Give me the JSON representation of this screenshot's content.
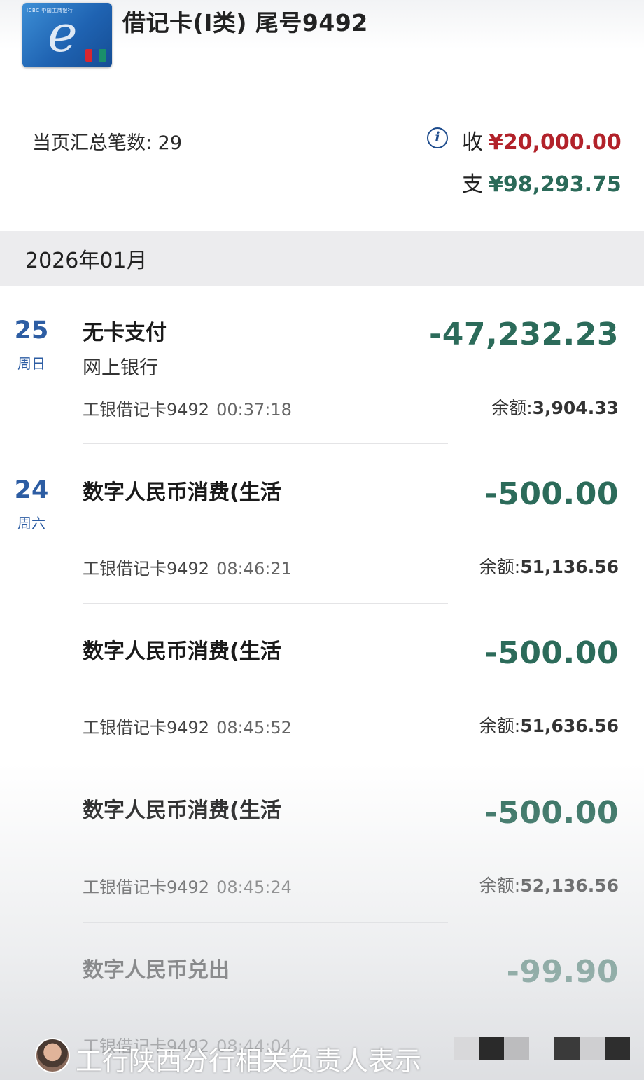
{
  "header": {
    "card_thumb_text": "ICBC 中国工商银行",
    "card_title": "借记卡(I类) 尾号9492",
    "summary_count": "当页汇总笔数: 29",
    "income_label": "收",
    "income_amount": "¥20,000.00",
    "expense_label": "支",
    "expense_amount": "¥98,293.75",
    "info_icon_glyph": "i"
  },
  "month": "2026年01月",
  "transactions": [
    {
      "day": "25",
      "weekday": "周日",
      "title": "无卡支付",
      "subtitle": "网上银行",
      "account": "工银借记卡9492",
      "time": "00:37:18",
      "amount": "-47,232.23",
      "balance_label": "余额:",
      "balance": "3,904.33"
    },
    {
      "day": "24",
      "weekday": "周六",
      "title": "数字人民币消费(生活",
      "subtitle": "",
      "account": "工银借记卡9492",
      "time": "08:46:21",
      "amount": "-500.00",
      "balance_label": "余额:",
      "balance": "51,136.56"
    },
    {
      "day": "",
      "weekday": "",
      "title": "数字人民币消费(生活",
      "subtitle": "",
      "account": "工银借记卡9492",
      "time": "08:45:52",
      "amount": "-500.00",
      "balance_label": "余额:",
      "balance": "51,636.56"
    },
    {
      "day": "",
      "weekday": "",
      "title": "数字人民币消费(生活",
      "subtitle": "",
      "account": "工银借记卡9492",
      "time": "08:45:24",
      "amount": "-500.00",
      "balance_label": "余额:",
      "balance": "52,136.56"
    },
    {
      "day": "",
      "weekday": "",
      "title": "数字人民币兑出",
      "subtitle": "",
      "account": "工银借记卡9492",
      "time": "08:44:04",
      "amount": "-99.90",
      "balance_label": "",
      "balance": ""
    }
  ],
  "overlay": {
    "caption": "工行陕西分行相关负责人表示"
  },
  "colors": {
    "income": "#b2222a",
    "expense": "#2b6a59",
    "date_blue": "#2d5da3"
  }
}
